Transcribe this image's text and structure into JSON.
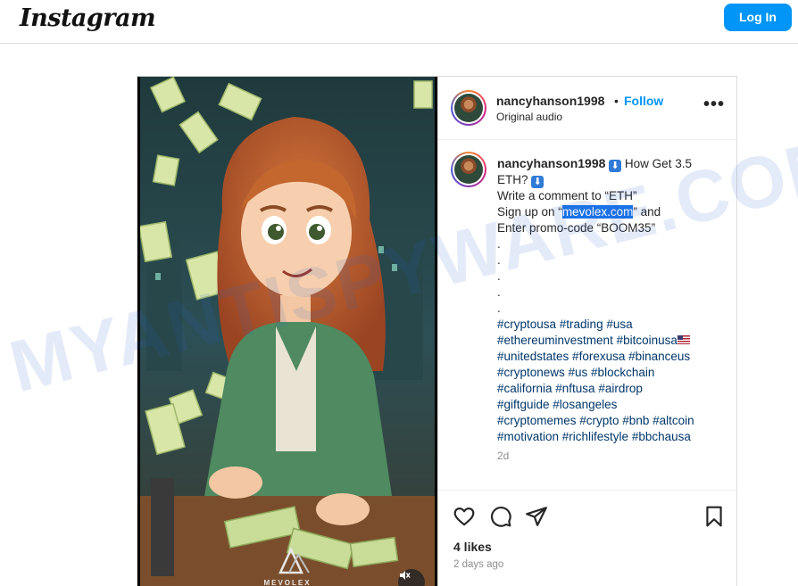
{
  "app": {
    "logo_text": "Instagram",
    "login_label": "Log In"
  },
  "post": {
    "username": "nancyhanson1998",
    "separator": "•",
    "follow_label": "Follow",
    "audio": "Original audio",
    "more_icon": "more-horizontal-icon",
    "caption": {
      "intro": "How Get 3.5",
      "intro_line2": "ETH?",
      "line3": "Write a comment to “ETH”",
      "line4_pre": "Sign up on “",
      "line4_link": "mevolex.com",
      "line4_post": "” and",
      "line5": "Enter promo-code “BOOM35”",
      "dots": [
        ".",
        ".",
        ".",
        ".",
        "."
      ],
      "hashtag_lines": [
        "#cryptousa #trading #usa",
        "#ethereuminvestment #bitcoinusa",
        "#unitedstates #forexusa #binanceus",
        "#cryptonews #us #blockchain",
        "#california #nftusa #airdrop",
        "#giftguide #losangeles",
        "#cryptomemes #crypto #bnb #altcoin",
        "#motivation #richlifestyle #bbchausa"
      ],
      "time_ago": "2d"
    },
    "likes": "4 likes",
    "date": "2 days ago",
    "media_brand": "MEVOLEX"
  },
  "watermark": {
    "text": "MYANTISPYWARE.COM"
  },
  "colors": {
    "accent": "#0095f6",
    "hashtag": "#00376b",
    "muted": "#8e8e8e",
    "border": "#dbdbdb"
  }
}
